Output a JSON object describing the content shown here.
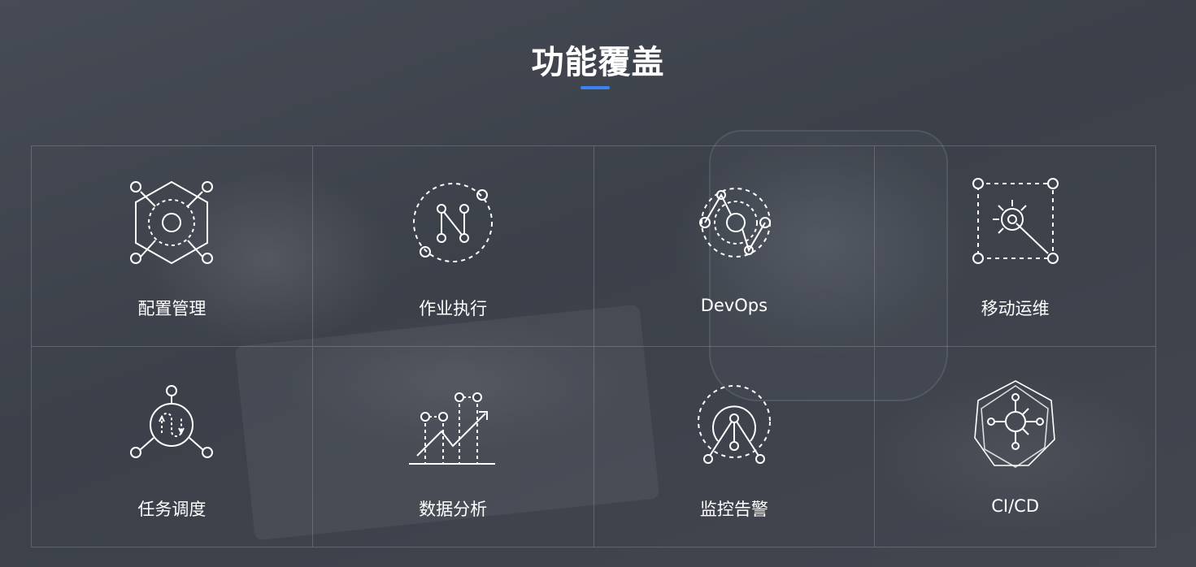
{
  "section": {
    "title": "功能覆盖",
    "accent_color": "#3b82f6"
  },
  "features": [
    {
      "label": "配置管理",
      "icon": "hexagon-network-icon"
    },
    {
      "label": "作业执行",
      "icon": "job-flow-icon"
    },
    {
      "label": "DevOps",
      "icon": "devops-cycle-icon"
    },
    {
      "label": "移动运维",
      "icon": "mobile-ops-icon"
    },
    {
      "label": "任务调度",
      "icon": "task-schedule-icon"
    },
    {
      "label": "数据分析",
      "icon": "data-analysis-icon"
    },
    {
      "label": "监控告警",
      "icon": "monitor-alert-icon"
    },
    {
      "label": "CI/CD",
      "icon": "ci-cd-icon"
    }
  ]
}
